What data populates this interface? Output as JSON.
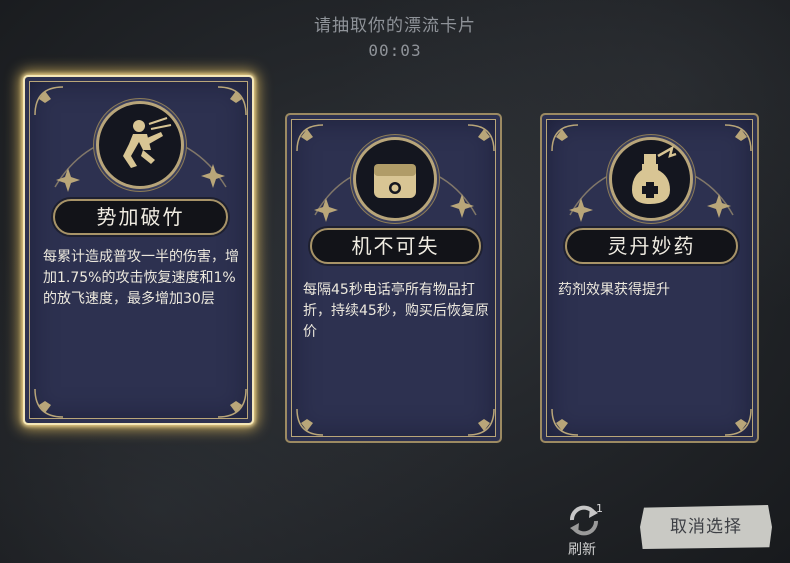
{
  "header": {
    "title": "请抽取你的漂流卡片",
    "timer": "00:03"
  },
  "cards": [
    {
      "name": "势加破竹",
      "icon": "running-figure-icon",
      "selected": true,
      "description": "每累计造成普攻一半的伤害，增加1.75%的攻击恢复速度和1%的放飞速度，最多增加30层"
    },
    {
      "name": "机不可失",
      "icon": "wallet-icon",
      "selected": false,
      "description": "每隔45秒电话亭所有物品打折，持续45秒，购买后恢复原价"
    },
    {
      "name": "灵丹妙药",
      "icon": "potion-bottle-icon",
      "selected": false,
      "description": "药剂效果获得提升"
    }
  ],
  "footer": {
    "refresh_label": "刷新",
    "refresh_count": "1",
    "cancel_label": "取消选择"
  },
  "colors": {
    "card_bg": "#2d3150",
    "frame_gold": "#b9a679",
    "selected_glow": "#f4e7b8"
  }
}
